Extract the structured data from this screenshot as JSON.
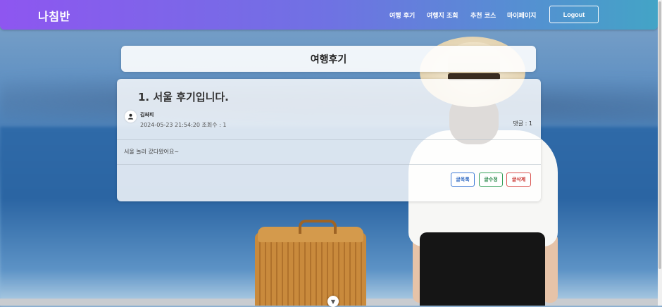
{
  "navbar": {
    "brand": "나침반",
    "links": [
      "여행 후기",
      "여행지 조회",
      "추천 코스",
      "마이페이지"
    ],
    "logout_label": "Logout"
  },
  "page": {
    "title": "여행후기"
  },
  "post": {
    "title": "1. 서울 후기입니다.",
    "author": "김싸피",
    "meta": "2024-05-23 21:54:20 조회수 : 1",
    "comments": "댓글 : 1",
    "body": "서울 놀러 갔다왔어요~"
  },
  "buttons": {
    "list": "글목록",
    "edit": "글수정",
    "delete": "글삭제"
  },
  "colors": {
    "navbar_start": "#8e56f0",
    "navbar_end": "#43a4c6",
    "list_button": "#3d7ad6",
    "edit_button": "#36a05a",
    "delete_button": "#d9534f"
  },
  "icons": {
    "avatar": "person-icon",
    "scroll": "chevron-down-icon"
  }
}
